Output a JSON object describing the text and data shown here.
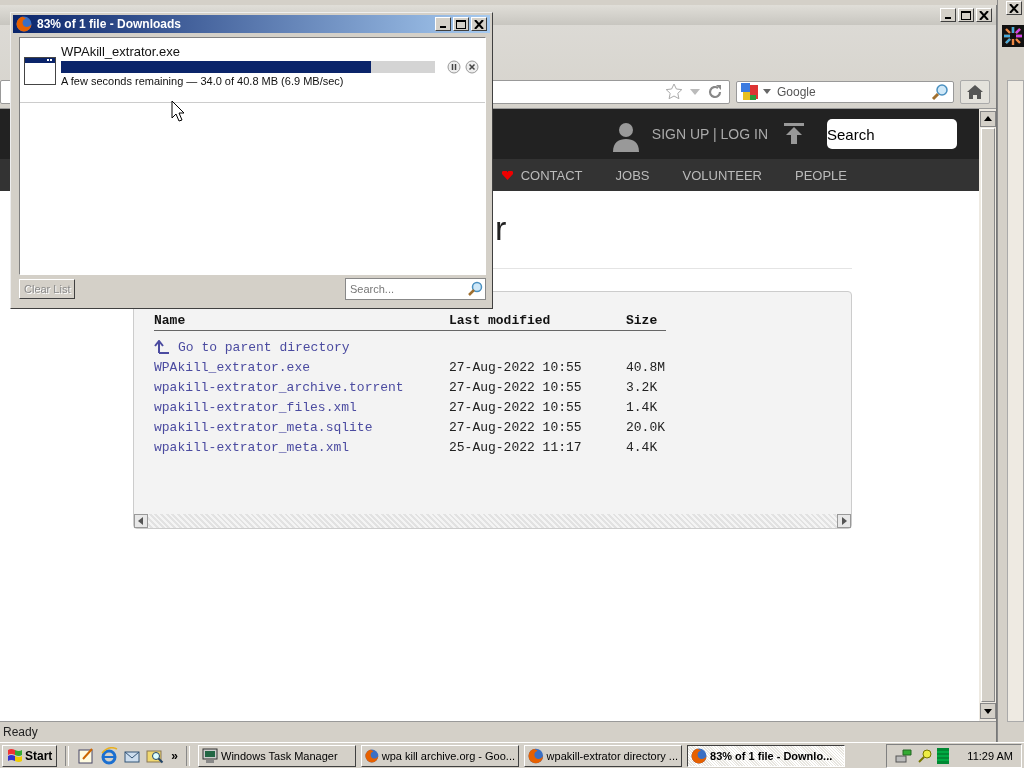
{
  "downloads_window": {
    "title": "83% of 1 file - Downloads",
    "item": {
      "filename": "WPAkill_extrator.exe",
      "level": 0.83,
      "status": "A few seconds remaining — 34.0 of 40.8 MB (6.9 MB/sec)"
    },
    "clear_button": {
      "label": "Clear List",
      "disabled": true
    },
    "search": {
      "placeholder": "Search..."
    }
  },
  "browser": {
    "search_box": {
      "placeholder": "Google"
    },
    "page": {
      "account_link": "SIGN UP | LOG IN",
      "search": {
        "placeholder": "Search"
      },
      "nav": [
        "CONTACT",
        "JOBS",
        "VOLUNTEER",
        "PEOPLE"
      ],
      "heading": "r",
      "listing": {
        "columns": [
          "Name",
          "Last modified",
          "Size"
        ],
        "parent_link": "Go to parent directory",
        "rows": [
          {
            "name": "WPAkill_extrator.exe",
            "modified": "27-Aug-2022 10:55",
            "size": "40.8M"
          },
          {
            "name": "wpakill-extrator_archive.torrent",
            "modified": "27-Aug-2022 10:55",
            "size": "3.2K"
          },
          {
            "name": "wpakill-extrator_files.xml",
            "modified": "27-Aug-2022 10:55",
            "size": "1.4K"
          },
          {
            "name": "wpakill-extrator_meta.sqlite",
            "modified": "27-Aug-2022 10:55",
            "size": "20.0K"
          },
          {
            "name": "wpakill-extrator_meta.xml",
            "modified": "25-Aug-2022 11:17",
            "size": "4.4K"
          }
        ]
      }
    },
    "status_bar": "Ready"
  },
  "taskbar": {
    "start": "Start",
    "quick_launch_more": "»",
    "tasks": [
      {
        "label": "Windows Task Manager",
        "kind": "monitor",
        "selected": false
      },
      {
        "label": "wpa kill archive.org - Goo...",
        "kind": "browser",
        "selected": false
      },
      {
        "label": "wpakill-extrator directory ...",
        "kind": "browser",
        "selected": false
      },
      {
        "label": "83% of 1 file - Downlo...",
        "kind": "browser",
        "selected": true
      }
    ],
    "clock": "11:29 AM"
  }
}
